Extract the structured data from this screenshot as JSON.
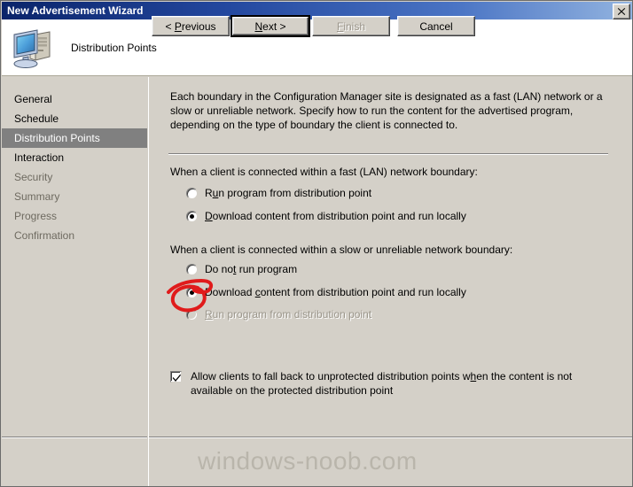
{
  "window": {
    "title": "New Advertisement Wizard",
    "close_label": "Close"
  },
  "header": {
    "title": "Distribution Points",
    "icon": "computer-icon"
  },
  "sidebar": {
    "items": [
      {
        "label": "General",
        "state": "normal"
      },
      {
        "label": "Schedule",
        "state": "normal"
      },
      {
        "label": "Distribution Points",
        "state": "selected"
      },
      {
        "label": "Interaction",
        "state": "normal"
      },
      {
        "label": "Security",
        "state": "dim"
      },
      {
        "label": "Summary",
        "state": "dim"
      },
      {
        "label": "Progress",
        "state": "dim"
      },
      {
        "label": "Confirmation",
        "state": "dim"
      }
    ]
  },
  "content": {
    "intro": "Each boundary in the Configuration Manager site is designated as a fast (LAN) network or a slow or unreliable network. Specify how to run the content for the advertised program, depending on the type of boundary the client is connected to.",
    "fast_group": {
      "label": "When a client is connected within a fast (LAN) network boundary:",
      "options": [
        {
          "label": "Run program from distribution point",
          "accel": "u",
          "checked": false,
          "enabled": true
        },
        {
          "label": "Download content from distribution point and run locally",
          "accel": "D",
          "checked": true,
          "enabled": true
        }
      ]
    },
    "slow_group": {
      "label": "When a client is connected within a slow or unreliable network boundary:",
      "options": [
        {
          "label": "Do not run program",
          "accel": "t",
          "checked": false,
          "enabled": true
        },
        {
          "label": "Download content from distribution point and run locally",
          "accel": "c",
          "checked": true,
          "enabled": true
        },
        {
          "label": "Run program from distribution point",
          "accel": "R",
          "checked": false,
          "enabled": false
        }
      ]
    },
    "fallback_checkbox": {
      "label": "Allow clients to fall back to unprotected distribution points when the content is not available on the protected distribution point",
      "checked": true
    }
  },
  "footer": {
    "buttons": [
      {
        "id": "previous",
        "label": "< Previous",
        "enabled": true,
        "default": false
      },
      {
        "id": "next",
        "label": "Next >",
        "enabled": true,
        "default": true
      },
      {
        "id": "finish",
        "label": "Finish",
        "enabled": false,
        "default": false
      },
      {
        "id": "cancel",
        "label": "Cancel",
        "enabled": true,
        "default": false
      }
    ]
  },
  "watermark": {
    "text": "windows-noob.com"
  },
  "annotation": {
    "type": "hand-drawn-circle",
    "color": "#e01b1b",
    "targets": "slow-group-download-radio"
  },
  "colors": {
    "titlebar_start": "#0a246a",
    "titlebar_end": "#93b4e0",
    "dialog_face": "#d4d0c8",
    "selected_nav": "#808080",
    "annotation_red": "#e01b1b",
    "watermark_gray": "#b9b5ab"
  }
}
